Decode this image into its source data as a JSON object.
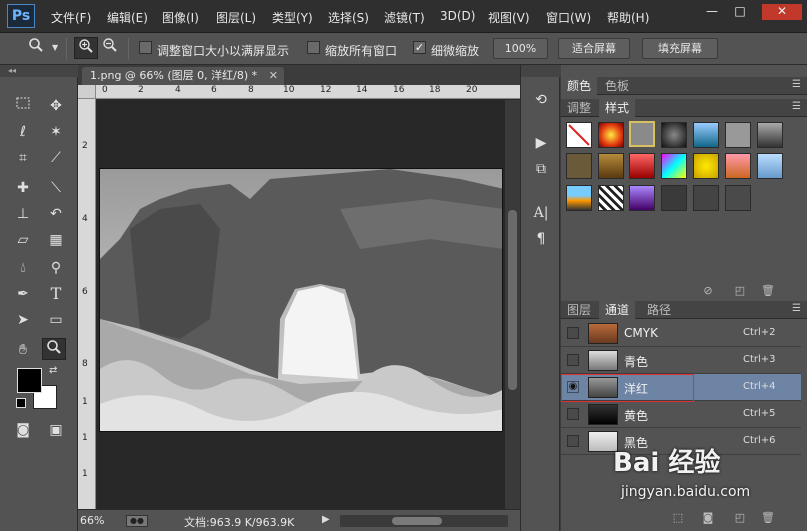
{
  "app": {
    "logo": "Ps",
    "menu": [
      "文件(F)",
      "编辑(E)",
      "图像(I)",
      "图层(L)",
      "类型(Y)",
      "选择(S)",
      "滤镜(T)",
      "3D(D)",
      "视图(V)",
      "窗口(W)",
      "帮助(H)"
    ],
    "window_controls": {
      "minimize": "—",
      "maximize": "□",
      "close": "✕"
    }
  },
  "options": {
    "resize_windows_label": "调整窗口大小以满屏显示",
    "zoom_all_label": "缩放所有窗口",
    "scrubby_zoom_label": "细微缩放",
    "scrubby_checked": true,
    "zoom_100_label": "100%",
    "fit_screen_label": "适合屏幕",
    "fill_screen_label": "填充屏幕"
  },
  "document": {
    "tab_title": "1.png @ 66% (图层 0, 洋红/8) *",
    "close": "✕",
    "ruler_top": [
      "0",
      "2",
      "4",
      "6",
      "8",
      "10",
      "12",
      "14",
      "16",
      "18",
      "20"
    ],
    "ruler_left": [
      "2",
      "4",
      "6",
      "8",
      "1",
      "1",
      "1"
    ],
    "zoom": "66%",
    "doc_size": "文档:963.9 K/963.9K"
  },
  "panels": {
    "color_tabs": [
      "颜色",
      "色板"
    ],
    "style_tabs": [
      "调整",
      "样式"
    ],
    "layer_tabs": [
      "图层",
      "通道",
      "路径"
    ],
    "channels": [
      {
        "name": "CMYK",
        "shortcut": "Ctrl+2",
        "visible": false
      },
      {
        "name": "青色",
        "shortcut": "Ctrl+3",
        "visible": false
      },
      {
        "name": "洋红",
        "shortcut": "Ctrl+4",
        "visible": true
      },
      {
        "name": "黄色",
        "shortcut": "Ctrl+5",
        "visible": false
      },
      {
        "name": "黑色",
        "shortcut": "Ctrl+6",
        "visible": false
      }
    ],
    "active_channel": "洋红"
  },
  "watermark": {
    "brand": "Bai 经验",
    "url": "jingyan.baidu.com"
  },
  "colors": {
    "highlight_box": "#e03030",
    "active_row": "#6e84a5",
    "foreground": "#000000",
    "background": "#ffffff"
  }
}
